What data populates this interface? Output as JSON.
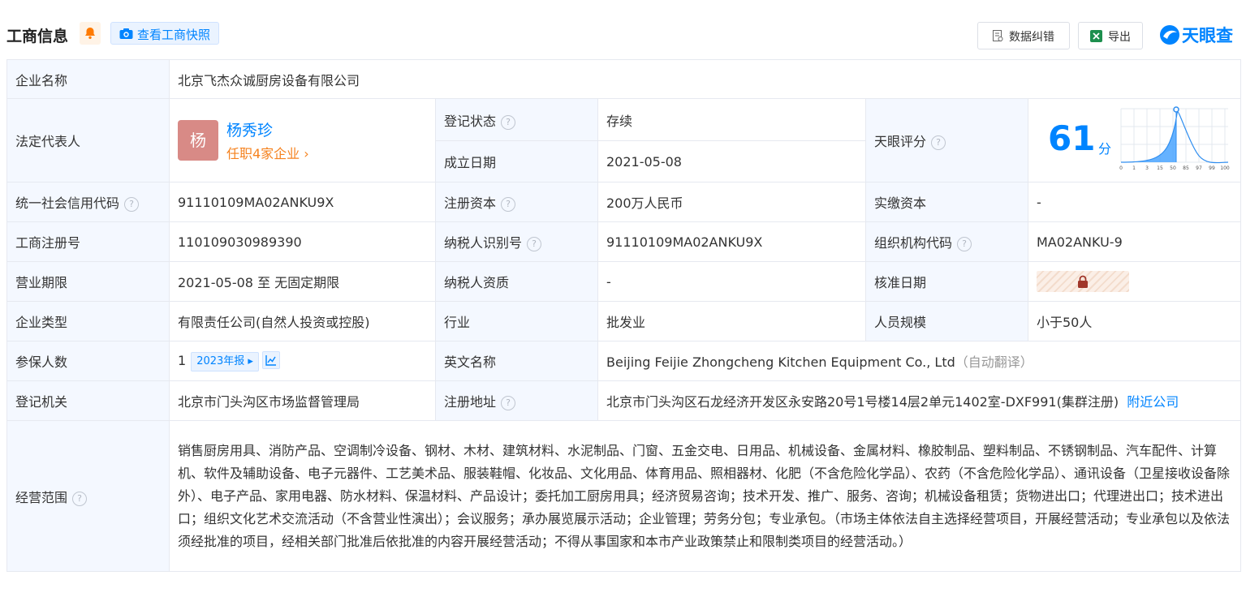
{
  "header": {
    "title": "工商信息",
    "snapshot_label": "查看工商快照",
    "correct_label": "数据纠错",
    "export_label": "导出",
    "logo_text": "天眼查"
  },
  "company": {
    "name_label": "企业名称",
    "name": "北京飞杰众诚厨房设备有限公司",
    "legal_rep_label": "法定代表人",
    "legal_rep_avatar": "杨",
    "legal_rep_name": "杨秀珍",
    "legal_rep_companies": "任职4家企业 ›",
    "reg_status_label": "登记状态",
    "reg_status": "存续",
    "found_date_label": "成立日期",
    "found_date": "2021-05-08",
    "score_label": "天眼评分",
    "score": "61",
    "score_unit": "分",
    "score_ticks": [
      "0",
      "1",
      "3",
      "15",
      "50",
      "85",
      "97",
      "99",
      "100"
    ],
    "credit_code_label": "统一社会信用代码",
    "credit_code": "91110109MA02ANKU9X",
    "reg_capital_label": "注册资本",
    "reg_capital": "200万人民币",
    "paid_capital_label": "实缴资本",
    "paid_capital": "-",
    "reg_no_label": "工商注册号",
    "reg_no": "110109030989390",
    "taxpayer_id_label": "纳税人识别号",
    "taxpayer_id": "91110109MA02ANKU9X",
    "org_code_label": "组织机构代码",
    "org_code": "MA02ANKU-9",
    "term_label": "营业期限",
    "term": "2021-05-08 至 无固定期限",
    "taxpayer_qual_label": "纳税人资质",
    "taxpayer_qual": "-",
    "approve_date_label": "核准日期",
    "type_label": "企业类型",
    "type": "有限责任公司(自然人投资或控股)",
    "industry_label": "行业",
    "industry": "批发业",
    "staff_label": "人员规模",
    "staff": "小于50人",
    "insured_label": "参保人数",
    "insured": "1",
    "insured_report": "2023年报 ▸",
    "en_name_label": "英文名称",
    "en_name": "Beijing Feijie Zhongcheng Kitchen Equipment Co., Ltd",
    "en_name_note": "（自动翻译）",
    "authority_label": "登记机关",
    "authority": "北京市门头沟区市场监督管理局",
    "address_label": "注册地址",
    "address": "北京市门头沟区石龙经济开发区永安路20号1号楼14层2单元1402室-DXF991(集群注册)",
    "nearby_label": "附近公司",
    "scope_label": "经营范围",
    "scope": "销售厨房用具、消防产品、空调制冷设备、钢材、木材、建筑材料、水泥制品、门窗、五金交电、日用品、机械设备、金属材料、橡胶制品、塑料制品、不锈钢制品、汽车配件、计算机、软件及辅助设备、电子元器件、工艺美术品、服装鞋帽、化妆品、文化用品、体育用品、照相器材、化肥（不含危险化学品）、农药（不含危险化学品）、通讯设备（卫星接收设备除外）、电子产品、家用电器、防水材料、保温材料、产品设计；委托加工厨房用具；经济贸易咨询；技术开发、推广、服务、咨询；机械设备租赁；货物进出口；代理进出口；技术进出口；组织文化艺术交流活动（不含营业性演出）；会议服务；承办展览展示活动；企业管理；劳务分包；专业承包。（市场主体依法自主选择经营项目，开展经营活动；专业承包以及依法须经批准的项目，经相关部门批准后依批准的内容开展经营活动；不得从事国家和本市产业政策禁止和限制类项目的经营活动。）"
  },
  "colors": {
    "accent": "#0084ff",
    "label_bg": "#f4f8ff",
    "status_green": "#1a9c4a",
    "orange": "#f5821f"
  }
}
